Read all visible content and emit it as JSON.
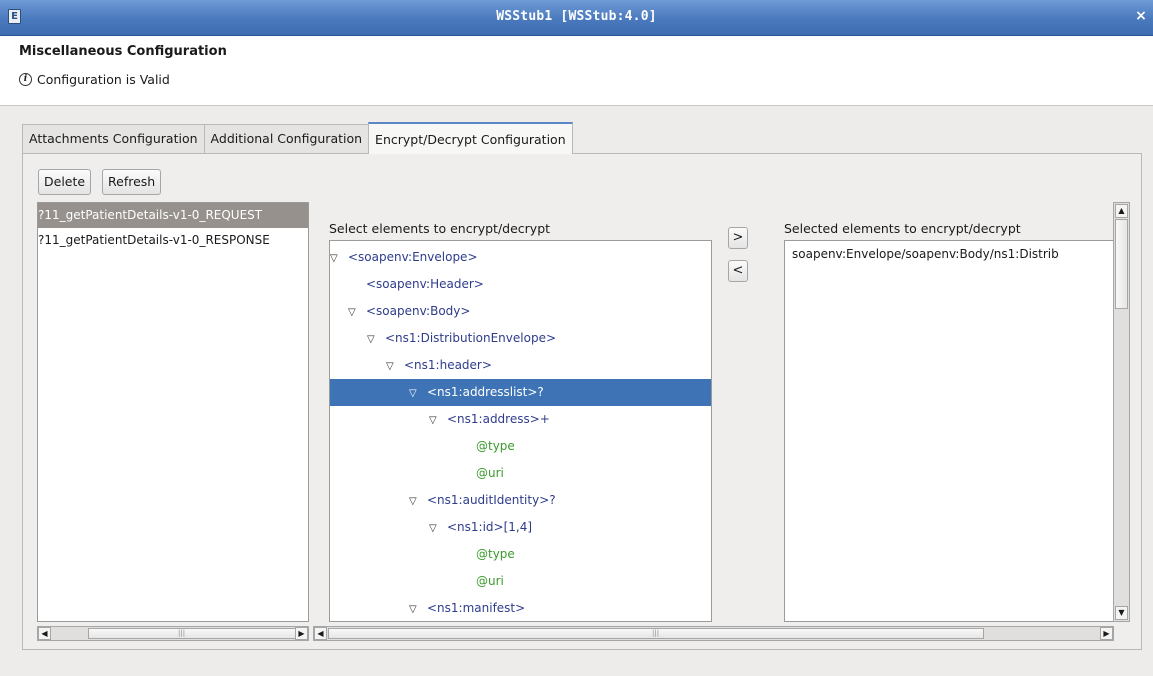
{
  "window": {
    "title": "WSStub1 [WSStub:4.0]",
    "app_icon": "app-icon",
    "close_label": "×"
  },
  "header": {
    "page_title": "Miscellaneous Configuration",
    "status_icon": "info-icon",
    "status_text": "Configuration is Valid"
  },
  "tabs": [
    {
      "label": "Attachments Configuration",
      "active": false
    },
    {
      "label": "Additional Configuration",
      "active": false
    },
    {
      "label": "Encrypt/Decrypt Configuration",
      "active": true
    }
  ],
  "toolbar": {
    "delete_label": "Delete",
    "refresh_label": "Refresh"
  },
  "operations": {
    "items": [
      {
        "label": "?11_getPatientDetails-v1-0_REQUEST",
        "selected": true
      },
      {
        "label": "?11_getPatientDetails-v1-0_RESPONSE",
        "selected": false
      }
    ]
  },
  "tree_panel": {
    "label": "Select elements to encrypt/decrypt",
    "rows": [
      {
        "text": "<soapenv:Envelope>",
        "depth": 0,
        "expanded": true,
        "kind": "element",
        "selected": false
      },
      {
        "text": "<soapenv:Header>",
        "depth": 1,
        "expanded": null,
        "kind": "element",
        "selected": false
      },
      {
        "text": "<soapenv:Body>",
        "depth": 1,
        "expanded": true,
        "kind": "element",
        "selected": false
      },
      {
        "text": "<ns1:DistributionEnvelope>",
        "depth": 2,
        "expanded": true,
        "kind": "element",
        "selected": false
      },
      {
        "text": "<ns1:header>",
        "depth": 3,
        "expanded": true,
        "kind": "element",
        "selected": false
      },
      {
        "text": "<ns1:addresslist>?",
        "depth": 4,
        "expanded": true,
        "kind": "element",
        "selected": true
      },
      {
        "text": "<ns1:address>+",
        "depth": 5,
        "expanded": true,
        "kind": "element",
        "selected": false
      },
      {
        "text": "@type",
        "depth": 7,
        "expanded": null,
        "kind": "attribute",
        "selected": false
      },
      {
        "text": "@uri",
        "depth": 7,
        "expanded": null,
        "kind": "attribute",
        "selected": false
      },
      {
        "text": "<ns1:auditIdentity>?",
        "depth": 4,
        "expanded": true,
        "kind": "element",
        "selected": false
      },
      {
        "text": "<ns1:id>[1,4]",
        "depth": 5,
        "expanded": true,
        "kind": "element",
        "selected": false
      },
      {
        "text": "@type",
        "depth": 7,
        "expanded": null,
        "kind": "attribute",
        "selected": false
      },
      {
        "text": "@uri",
        "depth": 7,
        "expanded": null,
        "kind": "attribute",
        "selected": false
      },
      {
        "text": "<ns1:manifest>",
        "depth": 4,
        "expanded": true,
        "kind": "element",
        "selected": false
      }
    ]
  },
  "transfer": {
    "add_label": ">",
    "remove_label": "<"
  },
  "selected_panel": {
    "label": "Selected elements to encrypt/decrypt",
    "entries": [
      "soapenv:Envelope/soapenv:Body/ns1:Distrib"
    ]
  },
  "scrollbars": {
    "up_glyph": "▲",
    "down_glyph": "▼",
    "left_glyph": "◀",
    "right_glyph": "▶",
    "grip": "|||"
  },
  "colors": {
    "titlebar": "#4a79bd",
    "selection": "#3e74b6",
    "element_text": "#2e3c8c",
    "attribute_text": "#3b9b2c",
    "list_selection": "#96918c"
  }
}
